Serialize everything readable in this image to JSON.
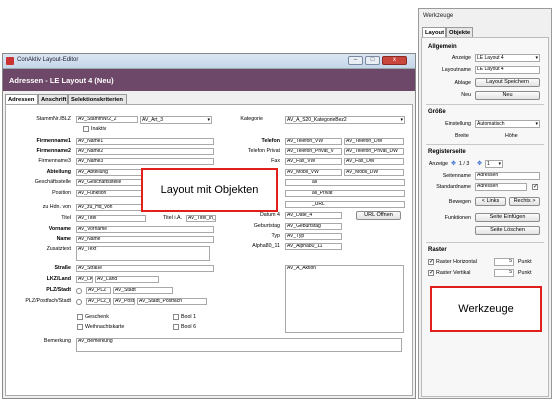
{
  "window": {
    "title": "ConAktiv Layout-Editor",
    "header": "Adressen - LE Layout 4 (Neu)",
    "tabs": [
      "Adressen",
      "Anschrift",
      "Selektionskriterien"
    ]
  },
  "form": {
    "stammnr_label": "StammNr./BLZ",
    "stammnr_value": "AV_StammNr2_2",
    "art_value": "AV_Art_3",
    "inaktiv_label": "Inaktiv",
    "kategorie_label": "Kategorie",
    "kategorie_value": "AV_A_S20_KategorieBez2",
    "firmenname1_label": "Firmenname1",
    "firmenname1_value": "AV_Name1",
    "firmenname2_label": "Firmenname2",
    "firmenname2_value": "AV_Name2",
    "firmenname3_label": "Firmenname3",
    "firmenname3_value": "AV_Name3",
    "abteilung_label": "Abteilung",
    "abteilung_value": "AV_Abteilung",
    "geschaeftsstelle_label": "Geschäftsstelle",
    "geschaeftsstelle_value": "AV_Geschäftsstelle",
    "position_label": "Position",
    "position_value": "AV_Funktion",
    "zuhdn_label": "zu Hdn. von",
    "zuhdn_value": "AV_zu_Hd_von",
    "titel_label": "Titel",
    "titel_value": "AV_Titel",
    "titelia_label": "Titel i.A.",
    "titelia_value": "AV_Titel_in_A",
    "vorname_label": "Vorname",
    "vorname_value": "AV_Vorname",
    "name_label": "Name",
    "name_value": "AV_Name",
    "zusatztext_label": "Zusatztext",
    "zusatztext_value": "AV_Text",
    "strasse_label": "Straße",
    "strasse_value": "AV_Straße",
    "lkzland_label": "LKZ/Land",
    "lkz_value": "AV_LK",
    "land_value": "AV_Land",
    "plzstadt_label": "PLZ/Stadt",
    "plz_value": "AV_PLZ",
    "stadt_value": "AV_Stadt",
    "plzpostfach_label": "PLZ/Postfach/Stadt",
    "plzpf_value": "AV_PLZ_P",
    "postfach_value": "AV_Postf",
    "stadtpf_value": "AV_Stadt_Postfach",
    "geschenk_label": "Geschenk",
    "weihnachtskarte_label": "Weihnachtskarte",
    "bool1_label": "Bool 1",
    "bool6_label": "Bool 6",
    "bemerkung_label": "Bemerkung",
    "bemerkung_value": "AV_Bemerkung",
    "telefon_label": "Telefon",
    "telefon_value": "AV_Telefon_VW",
    "telefon_dw": "AV_Telefon_DW",
    "telefonprivat_label": "Telefon Privat",
    "telefonprivat_value": "AV_Telefon_Privat_V",
    "telefonprivat_dw": "AV_Telefon_Privat_DW",
    "fax_label": "Fax",
    "fax_value": "AV_Fax_VW",
    "fax_dw": "AV_Fax_DW",
    "mobil_value": "AV_Mobil_VW",
    "mobil_dw": "AV_Mobil_DW",
    "mail_fragment": "ail",
    "privat_fragment": "ail_Privat",
    "url_fragment": "_URL",
    "datum4_label": "Datum 4",
    "datum4_value": "AV_Date_4",
    "url_oeffnen": "URL Öffnen",
    "geburtstag_label": "Geburtstag",
    "geburtstag_value": "AV_Geburtstag",
    "typ_label": "Typ",
    "typ_value": "AV_Typ",
    "alpha_label": "Alpha80_11",
    "alpha_value": "AV_Alpha80_11",
    "aktion_value": "AV_A_Aktion"
  },
  "overlay_main": "Layout mit Objekten",
  "overlay_tools": "Werkzeuge",
  "tools": {
    "title": "Werkzeuge",
    "tabs": [
      "Layout",
      "Objekte"
    ],
    "allgemein": {
      "heading": "Allgemein",
      "anzeige_label": "Anzeige",
      "anzeige_value": "LE Layout 4",
      "layoutname_label": "Layoutname",
      "layoutname_value": "LE Layout 4",
      "ablage_label": "Ablage",
      "ablage_value": "Layout Speichern",
      "neu_label": "Neu",
      "neu_value": "Neu"
    },
    "groesse": {
      "heading": "Größe",
      "einstellung_label": "Einstellung",
      "einstellung_value": "Automatisch",
      "breite_label": "Breite",
      "hoehe_label": "Höhe"
    },
    "registerseite": {
      "heading": "Registerseite",
      "anzeige_label": "Anzeige",
      "counter": "1 / 3",
      "page_value": "1",
      "seitenname_label": "Seitenname",
      "seitenname_value": "Adressen",
      "standardname_label": "Standardname",
      "standardname_value": "Adressen",
      "bewegen_label": "Bewegen",
      "links_label": "< Links",
      "rechts_label": "Rechts >",
      "funktionen_label": "Funktionen",
      "einfuegen_label": "Seite Einfügen",
      "loeschen_label": "Seite Löschen"
    },
    "raster": {
      "heading": "Raster",
      "horizontal_label": "Raster Horizontal",
      "horizontal_value": "5",
      "vertikal_label": "Raster Vertikal",
      "vertikal_value": "5",
      "unit": "Punkt"
    }
  }
}
